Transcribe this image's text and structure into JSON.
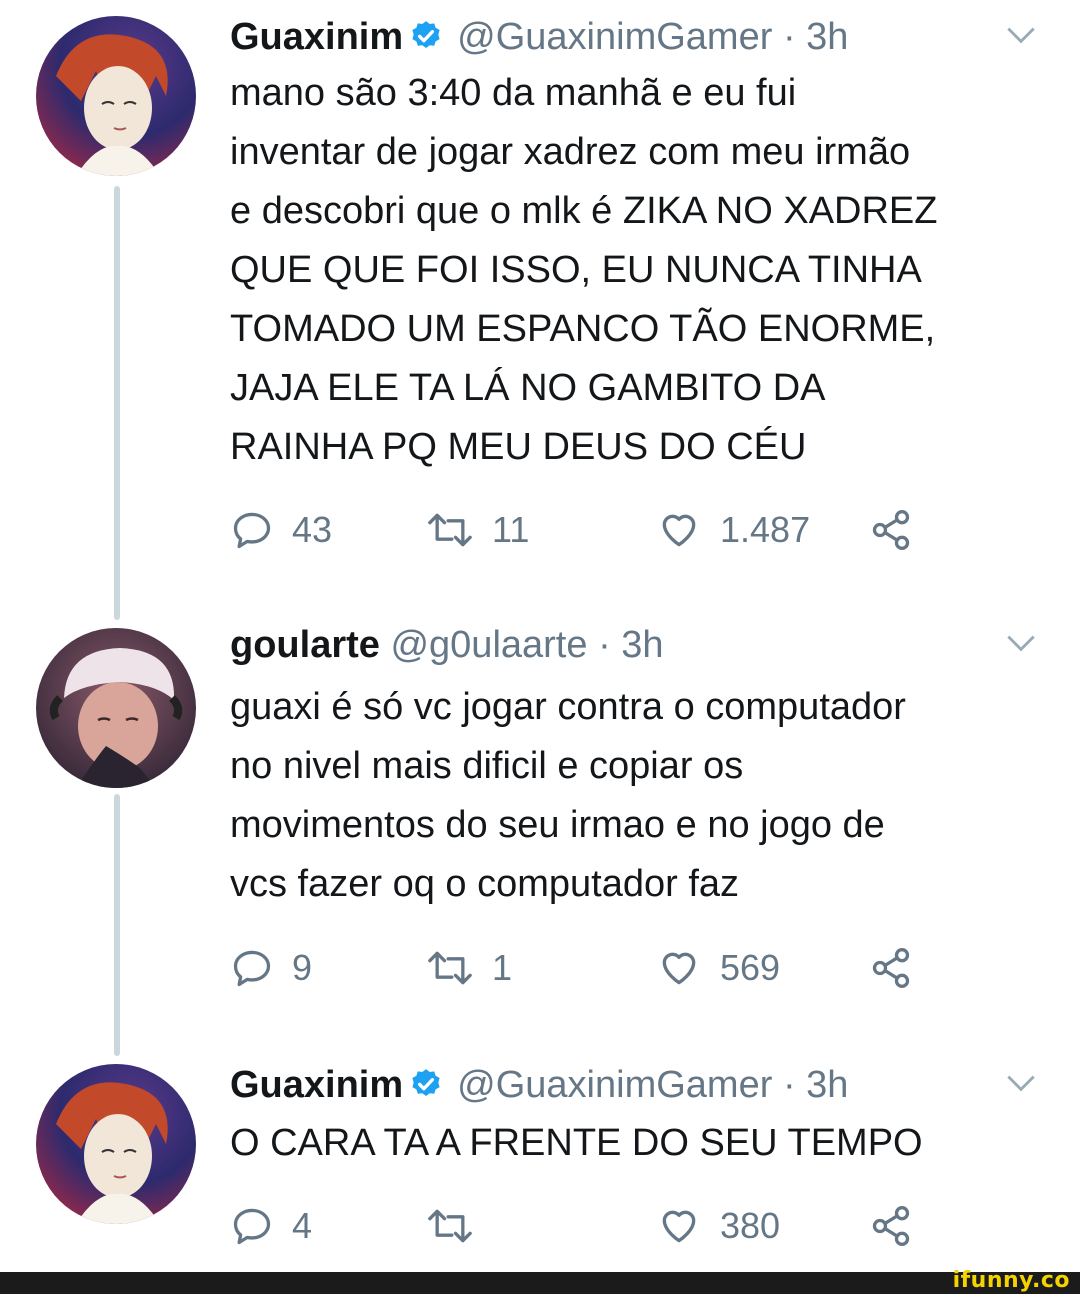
{
  "tweets": [
    {
      "name": "Guaxinim",
      "verified": true,
      "handle": "@GuaxinimGamer",
      "time": "· 3h",
      "text": "mano são 3:40 da manhã e eu fui\ninventar de jogar xadrez com meu irmão\ne descobri que o mlk é ZIKA NO XADREZ\nQUE QUE FOI ISSO, EU NUNCA TINHA\nTOMADO UM ESPANCO TÃO ENORME,\nJAJA ELE TA LÁ NO GAMBITO DA\nRAINHA PQ MEU DEUS DO CÉU",
      "replies": "43",
      "retweets": "11",
      "likes": "1.487"
    },
    {
      "name": "goularte",
      "verified": false,
      "handle": "@g0ulaarte",
      "time": "· 3h",
      "text": "guaxi é só vc jogar contra o computador\nno nivel mais dificil e copiar os\nmovimentos do seu irmao e no jogo de\nvcs fazer oq o computador faz",
      "replies": "9",
      "retweets": "1",
      "likes": "569"
    },
    {
      "name": "Guaxinim",
      "verified": true,
      "handle": "@GuaxinimGamer",
      "time": "· 3h",
      "text": "O CARA TA A FRENTE DO SEU TEMPO",
      "replies": "4",
      "retweets": "",
      "likes": "380"
    }
  ],
  "watermark": "ifunny.co",
  "colors": {
    "text": "#14171a",
    "secondary": "#657786",
    "verified": "#1da1f2",
    "thread_line": "#ccd6dd",
    "footer": "#1b1b1b",
    "brand": "#f5d300"
  }
}
